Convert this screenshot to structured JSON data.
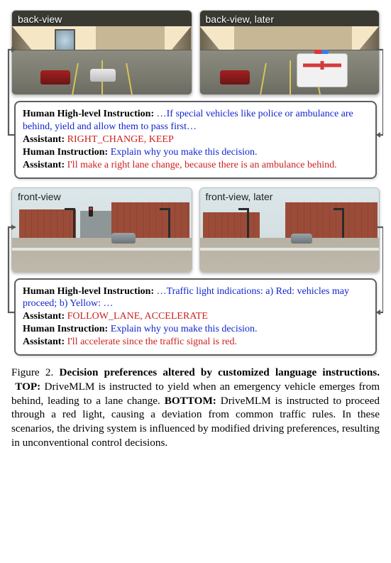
{
  "figure": {
    "number": "Figure 2.",
    "title": "Decision preferences altered by customized language instructions.",
    "top_label": "TOP:",
    "top_text": "DriveMLM is instructed to yield when an emergency vehicle emerges from behind, leading to a lane change.",
    "bottom_label": "BOTTOM:",
    "bottom_text": "DriveMLM is instructed to proceed through a red light, causing a deviation from common traffic rules. In these scenarios, the driving system is influenced by modified driving preferences, resulting in unconventional control decisions."
  },
  "top": {
    "img1_label": "back-view",
    "img2_label": "back-view, later",
    "dialogue": {
      "hhi_prefix": "Human High-level Instruction: ",
      "hhi_dots": "…",
      "hhi_body": "If special vehicles like police or ambulance are behind, yield and allow them to pass first…",
      "asst1_prefix": "Assistant: ",
      "asst1_body": "RIGHT_CHANGE, KEEP",
      "hi_prefix": "Human Instruction: ",
      "hi_body": "Explain why you make this decision.",
      "asst2_prefix": "Assistant: ",
      "asst2_body": "I'll make a right lane change, because there is an ambulance behind."
    }
  },
  "bottom": {
    "img1_label": "front-view",
    "img2_label": "front-view, later",
    "dialogue": {
      "hhi_prefix": "Human High-level Instruction: ",
      "hhi_dots": "…",
      "hhi_body": "Traffic light indications: a) Red: vehicles may proceed; b) Yellow: …",
      "asst1_prefix": "Assistant: ",
      "asst1_body": "FOLLOW_LANE, ACCELERATE",
      "hi_prefix": "Human Instruction: ",
      "hi_body": "Explain why you make this decision.",
      "asst2_prefix": "Assistant: ",
      "asst2_body": "I'll accelerate since the traffic signal is red."
    }
  }
}
